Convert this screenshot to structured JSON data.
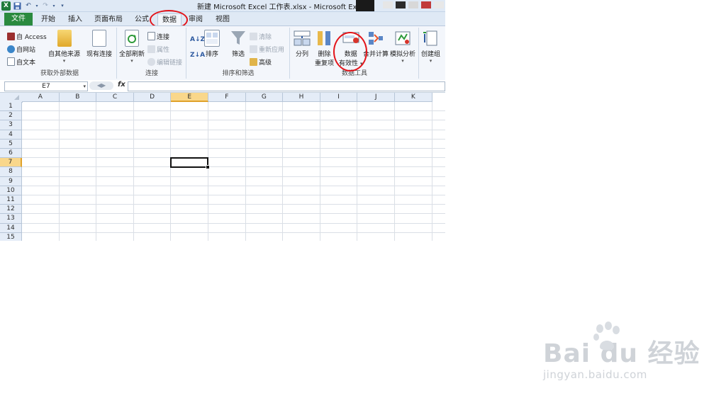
{
  "window": {
    "title": "新建 Microsoft Excel 工作表.xlsx - Microsoft Excel",
    "logo": "X"
  },
  "tabs": [
    {
      "label": "文件",
      "active": false
    },
    {
      "label": "开始",
      "active": false
    },
    {
      "label": "插入",
      "active": false
    },
    {
      "label": "页面布局",
      "active": false
    },
    {
      "label": "公式",
      "active": false
    },
    {
      "label": "数据",
      "active": true
    },
    {
      "label": "审阅",
      "active": false
    },
    {
      "label": "视图",
      "active": false
    }
  ],
  "ribbon": {
    "get_external": {
      "label": "获取外部数据",
      "from_access": "自 Access",
      "from_web": "自网站",
      "from_text": "自文本",
      "from_other": "自其他来源",
      "existing": "现有连接"
    },
    "connections": {
      "label": "连接",
      "refresh_all": "全部刷新",
      "connections": "连接",
      "properties": "属性",
      "edit_links": "编辑链接"
    },
    "sort_filter": {
      "label": "排序和筛选",
      "sort": "排序",
      "filter": "筛选",
      "clear": "清除",
      "reapply": "重新应用",
      "advanced": "高级"
    },
    "data_tools": {
      "label": "数据工具",
      "text_to_columns": "分列",
      "remove_dup_1": "删除",
      "remove_dup_2": "重复项",
      "validation_1": "数据",
      "validation_2": "有效性",
      "consolidate": "合并计算",
      "what_if": "模拟分析"
    },
    "outline": {
      "group": "创建组"
    }
  },
  "formula_bar": {
    "name_box": "E7",
    "fx": "fx",
    "value": ""
  },
  "sheet": {
    "columns": [
      "A",
      "B",
      "C",
      "D",
      "E",
      "F",
      "G",
      "H",
      "I",
      "J",
      "K"
    ],
    "rows": [
      "1",
      "2",
      "3",
      "4",
      "5",
      "6",
      "7",
      "8",
      "9",
      "10",
      "11",
      "12",
      "13",
      "14",
      "15"
    ],
    "active_col": "E",
    "active_row": "7"
  },
  "watermark": {
    "main": "Bai du 经验",
    "sub": "jingyan.baidu.com"
  },
  "colors": {
    "file_tab": "#2a8a3f",
    "highlight_circle": "#e3141a",
    "header_selected": "#f9d78b"
  }
}
